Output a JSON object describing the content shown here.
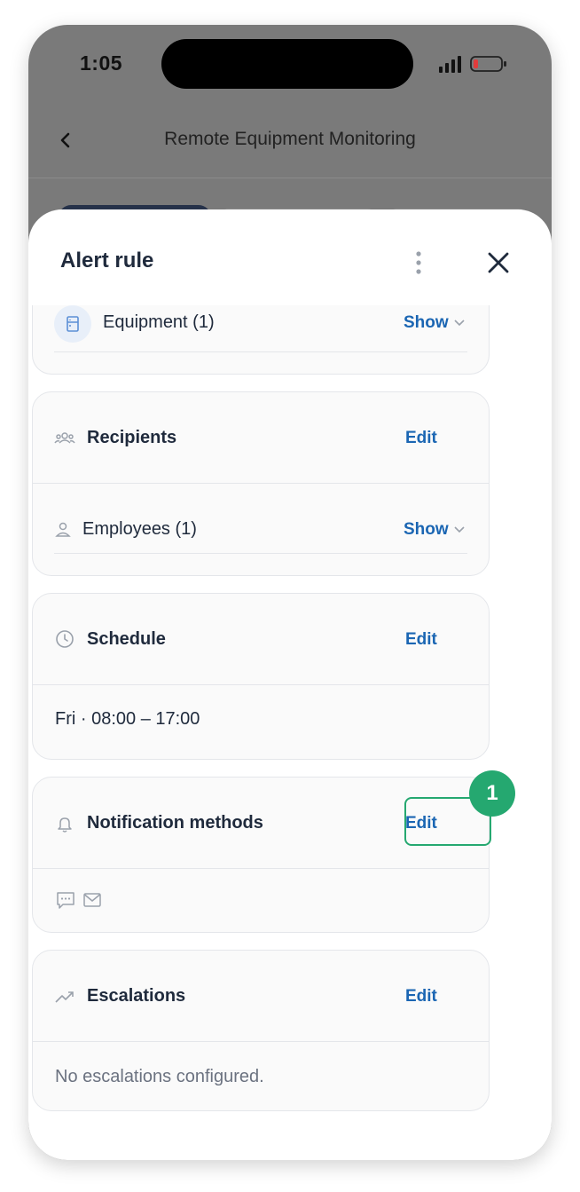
{
  "status_bar": {
    "time": "1:05"
  },
  "app_bar": {
    "title": "Remote Equipment Monitoring"
  },
  "sheet": {
    "title": "Alert rule",
    "equipment": {
      "label": "Equipment (1)",
      "action": "Show"
    },
    "recipients": {
      "title": "Recipients",
      "edit": "Edit",
      "employees": {
        "label": "Employees (1)",
        "action": "Show"
      }
    },
    "schedule": {
      "title": "Schedule",
      "edit": "Edit",
      "value": "Fri · 08:00 – 17:00"
    },
    "notification_methods": {
      "title": "Notification methods",
      "edit": "Edit",
      "methods": [
        "sms-icon",
        "email-icon"
      ]
    },
    "escalations": {
      "title": "Escalations",
      "edit": "Edit",
      "empty_text": "No escalations configured."
    }
  },
  "annotation": {
    "badge": "1",
    "color": "#25a870"
  },
  "colors": {
    "link": "#1b66b3",
    "title": "#1f2a3c",
    "card_bg": "#fafafa"
  }
}
